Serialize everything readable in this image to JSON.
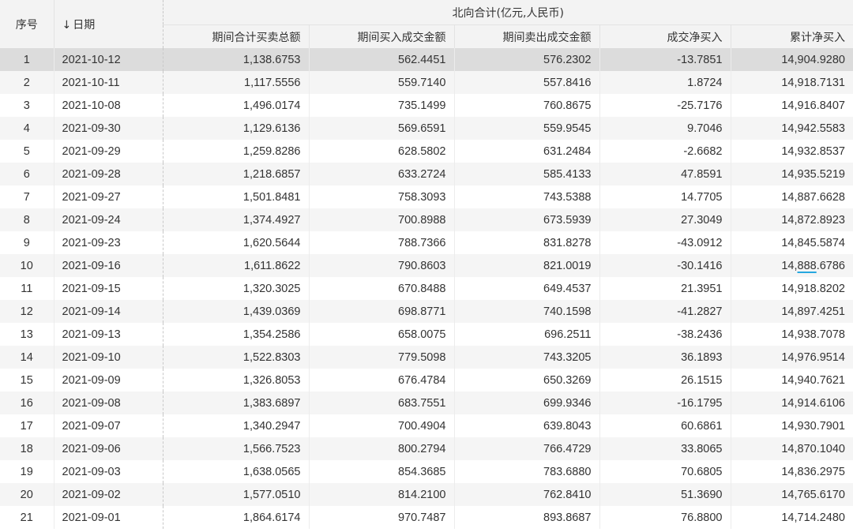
{
  "header": {
    "idx_label": "序号",
    "date_sort_icon": "↓",
    "date_label": "日期",
    "group_label": "北向合计(亿元,人民币)",
    "columns": [
      "期间合计买卖总额",
      "期间买入成交金额",
      "期间卖出成交金额",
      "成交净买入",
      "累计净买入"
    ]
  },
  "selected_row": 0,
  "rows": [
    {
      "idx": "1",
      "date": "2021-10-12",
      "total": "1,138.6753",
      "buy": "562.4451",
      "sell": "576.2302",
      "net": "-13.7851",
      "cum": "14,904.9280"
    },
    {
      "idx": "2",
      "date": "2021-10-11",
      "total": "1,117.5556",
      "buy": "559.7140",
      "sell": "557.8416",
      "net": "1.8724",
      "cum": "14,918.7131"
    },
    {
      "idx": "3",
      "date": "2021-10-08",
      "total": "1,496.0174",
      "buy": "735.1499",
      "sell": "760.8675",
      "net": "-25.7176",
      "cum": "14,916.8407"
    },
    {
      "idx": "4",
      "date": "2021-09-30",
      "total": "1,129.6136",
      "buy": "569.6591",
      "sell": "559.9545",
      "net": "9.7046",
      "cum": "14,942.5583"
    },
    {
      "idx": "5",
      "date": "2021-09-29",
      "total": "1,259.8286",
      "buy": "628.5802",
      "sell": "631.2484",
      "net": "-2.6682",
      "cum": "14,932.8537"
    },
    {
      "idx": "6",
      "date": "2021-09-28",
      "total": "1,218.6857",
      "buy": "633.2724",
      "sell": "585.4133",
      "net": "47.8591",
      "cum": "14,935.5219"
    },
    {
      "idx": "7",
      "date": "2021-09-27",
      "total": "1,501.8481",
      "buy": "758.3093",
      "sell": "743.5388",
      "net": "14.7705",
      "cum": "14,887.6628"
    },
    {
      "idx": "8",
      "date": "2021-09-24",
      "total": "1,374.4927",
      "buy": "700.8988",
      "sell": "673.5939",
      "net": "27.3049",
      "cum": "14,872.8923"
    },
    {
      "idx": "9",
      "date": "2021-09-23",
      "total": "1,620.5644",
      "buy": "788.7366",
      "sell": "831.8278",
      "net": "-43.0912",
      "cum": "14,845.5874"
    },
    {
      "idx": "10",
      "date": "2021-09-16",
      "total": "1,611.8622",
      "buy": "790.8603",
      "sell": "821.0019",
      "net": "-30.1416",
      "cum": "14,888.6786"
    },
    {
      "idx": "11",
      "date": "2021-09-15",
      "total": "1,320.3025",
      "buy": "670.8488",
      "sell": "649.4537",
      "net": "21.3951",
      "cum": "14,918.8202"
    },
    {
      "idx": "12",
      "date": "2021-09-14",
      "total": "1,439.0369",
      "buy": "698.8771",
      "sell": "740.1598",
      "net": "-41.2827",
      "cum": "14,897.4251"
    },
    {
      "idx": "13",
      "date": "2021-09-13",
      "total": "1,354.2586",
      "buy": "658.0075",
      "sell": "696.2511",
      "net": "-38.2436",
      "cum": "14,938.7078"
    },
    {
      "idx": "14",
      "date": "2021-09-10",
      "total": "1,522.8303",
      "buy": "779.5098",
      "sell": "743.3205",
      "net": "36.1893",
      "cum": "14,976.9514"
    },
    {
      "idx": "15",
      "date": "2021-09-09",
      "total": "1,326.8053",
      "buy": "676.4784",
      "sell": "650.3269",
      "net": "26.1515",
      "cum": "14,940.7621"
    },
    {
      "idx": "16",
      "date": "2021-09-08",
      "total": "1,383.6897",
      "buy": "683.7551",
      "sell": "699.9346",
      "net": "-16.1795",
      "cum": "14,914.6106"
    },
    {
      "idx": "17",
      "date": "2021-09-07",
      "total": "1,340.2947",
      "buy": "700.4904",
      "sell": "639.8043",
      "net": "60.6861",
      "cum": "14,930.7901"
    },
    {
      "idx": "18",
      "date": "2021-09-06",
      "total": "1,566.7523",
      "buy": "800.2794",
      "sell": "766.4729",
      "net": "33.8065",
      "cum": "14,870.1040"
    },
    {
      "idx": "19",
      "date": "2021-09-03",
      "total": "1,638.0565",
      "buy": "854.3685",
      "sell": "783.6880",
      "net": "70.6805",
      "cum": "14,836.2975"
    },
    {
      "idx": "20",
      "date": "2021-09-02",
      "total": "1,577.0510",
      "buy": "814.2100",
      "sell": "762.8410",
      "net": "51.3690",
      "cum": "14,765.6170"
    },
    {
      "idx": "21",
      "date": "2021-09-01",
      "total": "1,864.6174",
      "buy": "970.7487",
      "sell": "893.8687",
      "net": "76.8800",
      "cum": "14,714.2480"
    }
  ]
}
